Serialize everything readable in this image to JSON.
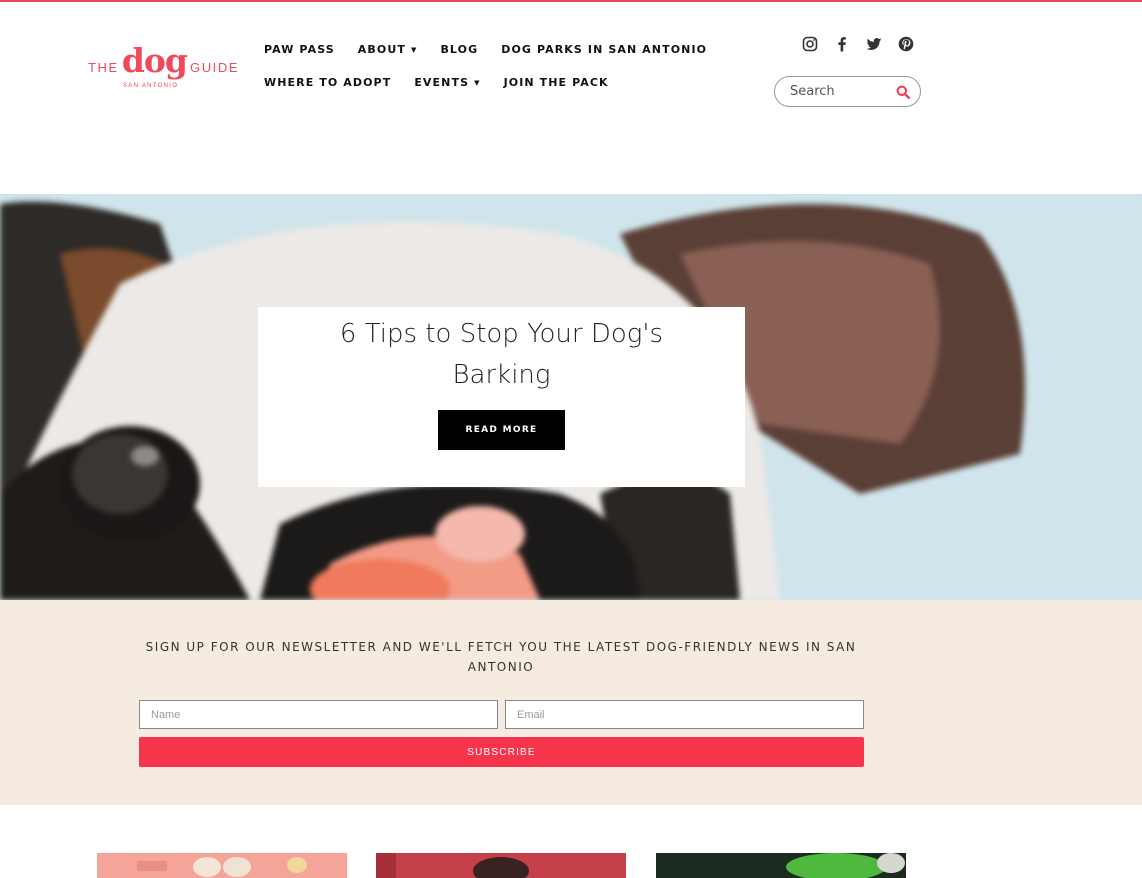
{
  "brand": {
    "logo_the": "THE",
    "logo_dog": "dog",
    "logo_guide": "GUIDE",
    "logo_sub": "SAN ANTONIO",
    "accent": "#ee4a5a"
  },
  "nav": {
    "row1": [
      {
        "label": "PAW PASS",
        "dropdown": false
      },
      {
        "label": "ABOUT",
        "dropdown": true
      },
      {
        "label": "BLOG",
        "dropdown": false
      },
      {
        "label": "DOG PARKS IN SAN ANTONIO",
        "dropdown": false
      }
    ],
    "row2": [
      {
        "label": "WHERE TO ADOPT",
        "dropdown": false
      },
      {
        "label": "EVENTS",
        "dropdown": true
      },
      {
        "label": "JOIN THE PACK",
        "dropdown": false
      }
    ],
    "caret": "▼"
  },
  "social": [
    "instagram-icon",
    "facebook-icon",
    "twitter-icon",
    "pinterest-icon"
  ],
  "search": {
    "placeholder": "Search",
    "value": ""
  },
  "hero": {
    "title": "6 Tips to Stop Your Dog's Barking",
    "button_label": "READ MORE"
  },
  "newsletter": {
    "text": "SIGN UP FOR OUR NEWSLETTER AND WE'LL FETCH YOU THE LATEST DOG-FRIENDLY NEWS IN SAN ANTONIO",
    "name_placeholder": "Name",
    "email_placeholder": "Email",
    "submit_label": "SUBSCRIBE",
    "background": "#f5ebe0",
    "button_color": "#f6354c"
  }
}
